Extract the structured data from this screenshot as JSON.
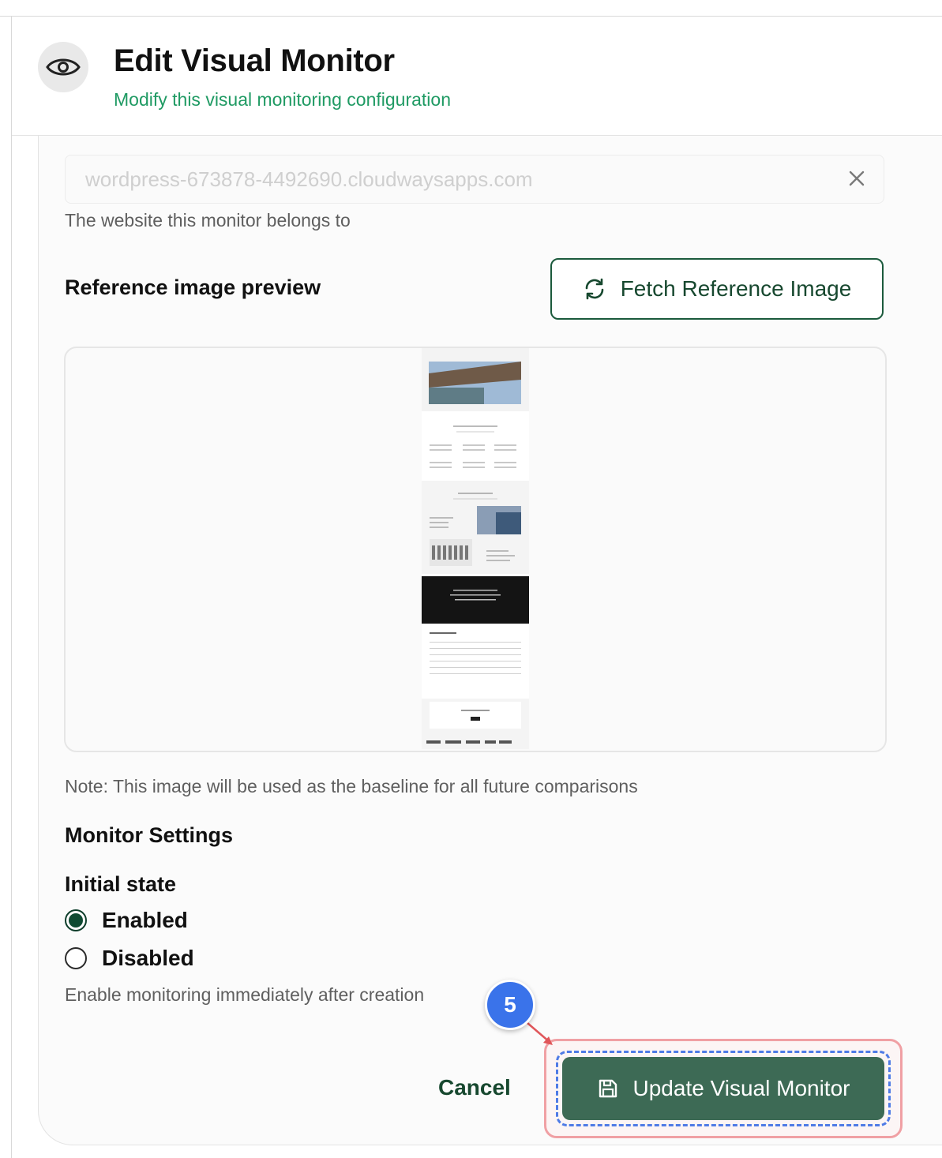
{
  "header": {
    "title": "Edit Visual Monitor",
    "subtitle": "Modify this visual monitoring configuration",
    "icon": "eye-icon"
  },
  "website_field": {
    "value": "wordpress-673878-4492690.cloudwaysapps.com",
    "help": "The website this monitor belongs to"
  },
  "reference": {
    "section_title": "Reference image preview",
    "fetch_button_label": "Fetch Reference Image",
    "note": "Note: This image will be used as the baseline for all future comparisons"
  },
  "settings": {
    "title": "Monitor Settings",
    "initial_state_label": "Initial state",
    "options": [
      {
        "label": "Enabled",
        "selected": true
      },
      {
        "label": "Disabled",
        "selected": false
      }
    ],
    "help": "Enable monitoring immediately after creation"
  },
  "actions": {
    "cancel_label": "Cancel",
    "update_label": "Update Visual Monitor"
  },
  "annotation": {
    "step_number": "5"
  },
  "colors": {
    "accent_green": "#1f9a63",
    "button_green": "#3d6a55",
    "highlight_red": "#f0a0a4",
    "highlight_blue": "#4f7be6",
    "badge_blue": "#3a73ea"
  }
}
